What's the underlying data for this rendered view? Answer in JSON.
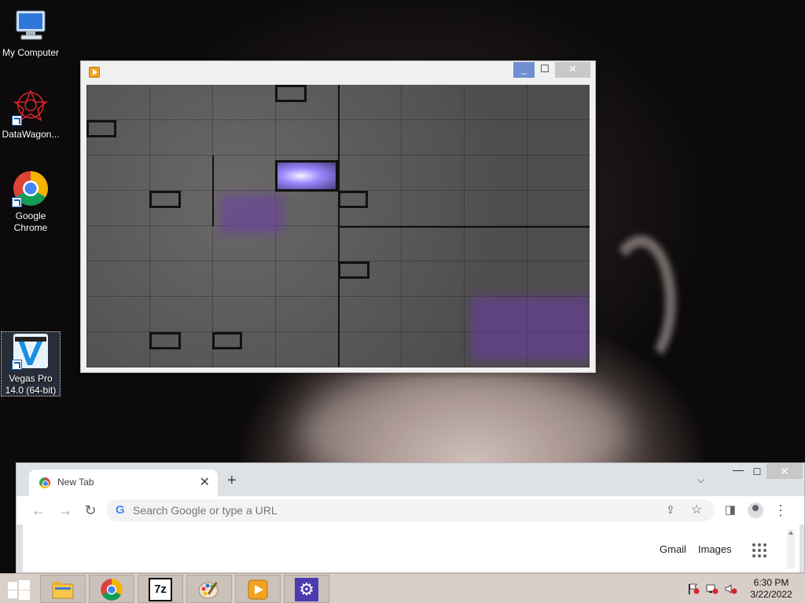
{
  "desktop": {
    "icons": [
      {
        "label": "My Computer",
        "icon": "computer-icon"
      },
      {
        "label": "DataWagon...",
        "icon": "datawagon-icon"
      },
      {
        "label": "Google Chrome",
        "icon": "chrome-icon"
      },
      {
        "label": "Vegas Pro 14.0 (64-bit)",
        "icon": "vegas-pro-icon"
      }
    ]
  },
  "video_window": {
    "minimize": "_",
    "maximize": "☐",
    "close": "✕"
  },
  "chrome": {
    "tab_title": "New Tab",
    "tab_close": "✕",
    "new_tab": "+",
    "tab_dropdown": "⌵",
    "minimize": "—",
    "maximize": "☐",
    "close": "✕",
    "back": "←",
    "forward": "→",
    "reload": "↻",
    "omnibox_g": "G",
    "omnibox_placeholder": "Search Google or type a URL",
    "share": "⇪",
    "star": "☆",
    "side_panel": "◨",
    "menu": "⋮",
    "gmail": "Gmail",
    "images": "Images"
  },
  "taskbar": {
    "apps": [
      {
        "name": "file-explorer-icon"
      },
      {
        "name": "chrome-icon"
      },
      {
        "name": "7zip-icon",
        "label": "7z"
      },
      {
        "name": "paint-icon"
      },
      {
        "name": "media-player-icon"
      },
      {
        "name": "settings-gear-icon",
        "label": "⚙"
      }
    ],
    "time": "6:30 PM",
    "date": "3/22/2022"
  },
  "colors": {
    "taskbar": "#d9cfc9",
    "chrome_frame": "#dee1e6",
    "window_min_active": "#6e8fd0"
  }
}
